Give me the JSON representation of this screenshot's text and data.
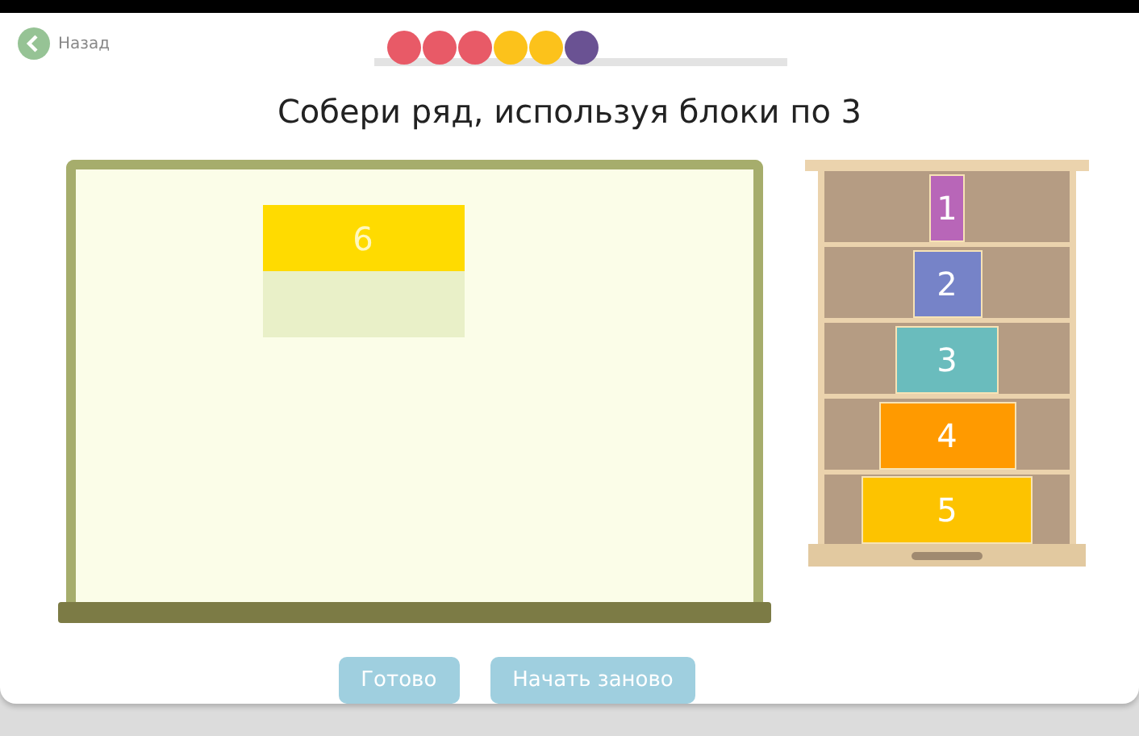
{
  "back": {
    "label": "Назад"
  },
  "progress": [
    {
      "color": "#e85a67"
    },
    {
      "color": "#e85a67"
    },
    {
      "color": "#e85a67"
    },
    {
      "color": "#fcc21b"
    },
    {
      "color": "#fcc21b"
    },
    {
      "color": "#6a5293"
    }
  ],
  "title": "Собери ряд, используя блоки по 3",
  "board": {
    "slots": [
      {
        "filled": true,
        "label": "6",
        "color": "#ffdb00"
      },
      {
        "filled": false
      }
    ]
  },
  "shelf": [
    {
      "label": "1",
      "color": "#b866b8"
    },
    {
      "label": "2",
      "color": "#7683c8"
    },
    {
      "label": "3",
      "color": "#6abcbd"
    },
    {
      "label": "4",
      "color": "#ff9a00"
    },
    {
      "label": "5",
      "color": "#fdc300"
    }
  ],
  "buttons": [
    {
      "label": "Готово",
      "disabled": true
    },
    {
      "label": "Начать заново",
      "disabled": true
    }
  ]
}
